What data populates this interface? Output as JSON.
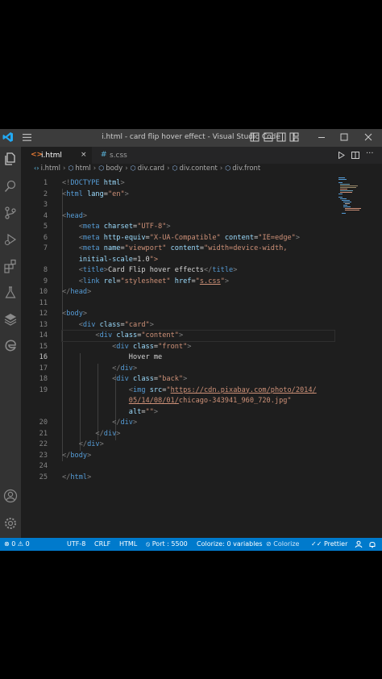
{
  "window": {
    "title": "i.html - card flip hover effect - Visual Studio Code"
  },
  "tabs": [
    {
      "icon": "<>",
      "label": "i.html",
      "close": "×",
      "active": true
    },
    {
      "icon": "#",
      "label": "s.css",
      "active": false
    }
  ],
  "breadcrumb": {
    "file": "i.html",
    "items": [
      "html",
      "body",
      "div.card",
      "div.content",
      "div.front"
    ]
  },
  "editor": {
    "current_line": 16,
    "lines": [
      {
        "n": "1",
        "html": "<span class=\"b\">&lt;!</span><span class=\"t\">DOCTYPE</span> <span class=\"a\">html</span><span class=\"b\">&gt;</span>",
        "text": "<!DOCTYPE html>"
      },
      {
        "n": "2",
        "text": "<html lang=\"en\">"
      },
      {
        "n": "3",
        "text": ""
      },
      {
        "n": "4",
        "text": "<head>"
      },
      {
        "n": "5",
        "text": "    <meta charset=\"UTF-8\">"
      },
      {
        "n": "6",
        "text": "    <meta http-equiv=\"X-UA-Compatible\" content=\"IE=edge\">"
      },
      {
        "n": "7",
        "text": "    <meta name=\"viewport\" content=\"width=device-width,"
      },
      {
        "n": "",
        "text": "    initial-scale=1.0\">"
      },
      {
        "n": "8",
        "text": "    <title>Card Flip hover effects</title>"
      },
      {
        "n": "9",
        "text": "    <link rel=\"stylesheet\" href=\"s.css\">"
      },
      {
        "n": "10",
        "text": "</head>"
      },
      {
        "n": "11",
        "text": ""
      },
      {
        "n": "12",
        "text": "<body>"
      },
      {
        "n": "13",
        "text": "    <div class=\"card\">"
      },
      {
        "n": "14",
        "text": "        <div class=\"content\">"
      },
      {
        "n": "15",
        "text": "            <div class=\"front\">"
      },
      {
        "n": "16",
        "text": "                Hover me"
      },
      {
        "n": "17",
        "text": "            </div>"
      },
      {
        "n": "18",
        "text": "            <div class=\"back\">"
      },
      {
        "n": "19",
        "text": "                <img src=\"https://cdn.pixabay.com/photo/2014/"
      },
      {
        "n": "",
        "text": "                05/14/08/01/chicago-343941_960_720.jpg\""
      },
      {
        "n": "",
        "text": "                alt=\"\">"
      },
      {
        "n": "20",
        "text": "            </div>"
      },
      {
        "n": "21",
        "text": "        </div>"
      },
      {
        "n": "22",
        "text": "    </div>"
      },
      {
        "n": "23",
        "text": "</body>"
      },
      {
        "n": "24",
        "text": ""
      },
      {
        "n": "25",
        "text": "</html>"
      }
    ]
  },
  "status": {
    "problems": "⊗ 0 ⚠ 0",
    "encoding": "UTF-8",
    "eol": "CRLF",
    "language": "HTML",
    "port": "⦸ Port : 5500",
    "colorize_vars": "Colorize: 0 variables",
    "colorize": "⊘ Colorize",
    "prettier": "✓✓ Prettier"
  },
  "colors": {
    "accent": "#007acc",
    "tag": "#569cd6",
    "attr": "#9cdcfe",
    "string": "#ce9178"
  }
}
